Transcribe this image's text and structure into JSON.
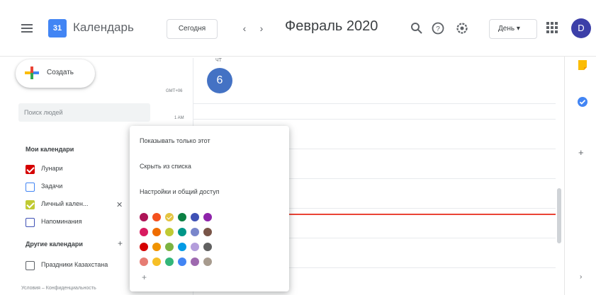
{
  "header": {
    "app_title": "Календарь",
    "logo_text": "31",
    "today_label": "Сегодня",
    "prev_glyph": "‹",
    "next_glyph": "›",
    "date_title": "Февраль 2020",
    "view_select": "День ▾",
    "avatar_letter": "D"
  },
  "sidebar": {
    "create_label": "Создать",
    "search_placeholder": "Поиск людей",
    "my_calendars_title": "Мои календари",
    "my_calendars": [
      {
        "label": "Лунари",
        "color": "#d50000",
        "checked": true
      },
      {
        "label": "Задачи",
        "color": "#4285f4",
        "checked": false
      },
      {
        "label": "Личный кален...",
        "color": "#c0ca33",
        "checked": true
      },
      {
        "label": "Напоминания",
        "color": "#3f51b5",
        "checked": false
      }
    ],
    "other_calendars_title": "Другие календари",
    "other_add_glyph": "+",
    "other_calendars": [
      {
        "label": "Праздники Казахстана",
        "color": "#5f6368",
        "checked": false
      }
    ],
    "footer": "Условия – Конфиденциальность"
  },
  "grid": {
    "day_abbr": "ЧТ",
    "day_number": "6",
    "tz_label": "GMT+06",
    "time_labels": [
      "1 AM"
    ]
  },
  "side_panel": {
    "add_glyph": "+",
    "arrow_glyph": "›"
  },
  "popup": {
    "items": [
      "Показывать только этот",
      "Скрыть из списка",
      "Настройки и общий доступ"
    ],
    "plus_glyph": "+",
    "palette": [
      [
        "#ad1457",
        "#f4511e",
        "#e4c441",
        "#0b8043",
        "#3f51b5",
        "#8e24aa"
      ],
      [
        "#d81b60",
        "#ef6c00",
        "#c0ca33",
        "#009688",
        "#7986cb",
        "#795548"
      ],
      [
        "#d50000",
        "#f09300",
        "#7cb342",
        "#039be5",
        "#b39ddb",
        "#616161"
      ],
      [
        "#e67c73",
        "#f6bf26",
        "#33b679",
        "#4285f4",
        "#9e69af",
        "#a79b8e"
      ]
    ],
    "selected_color": "#e4c441"
  }
}
